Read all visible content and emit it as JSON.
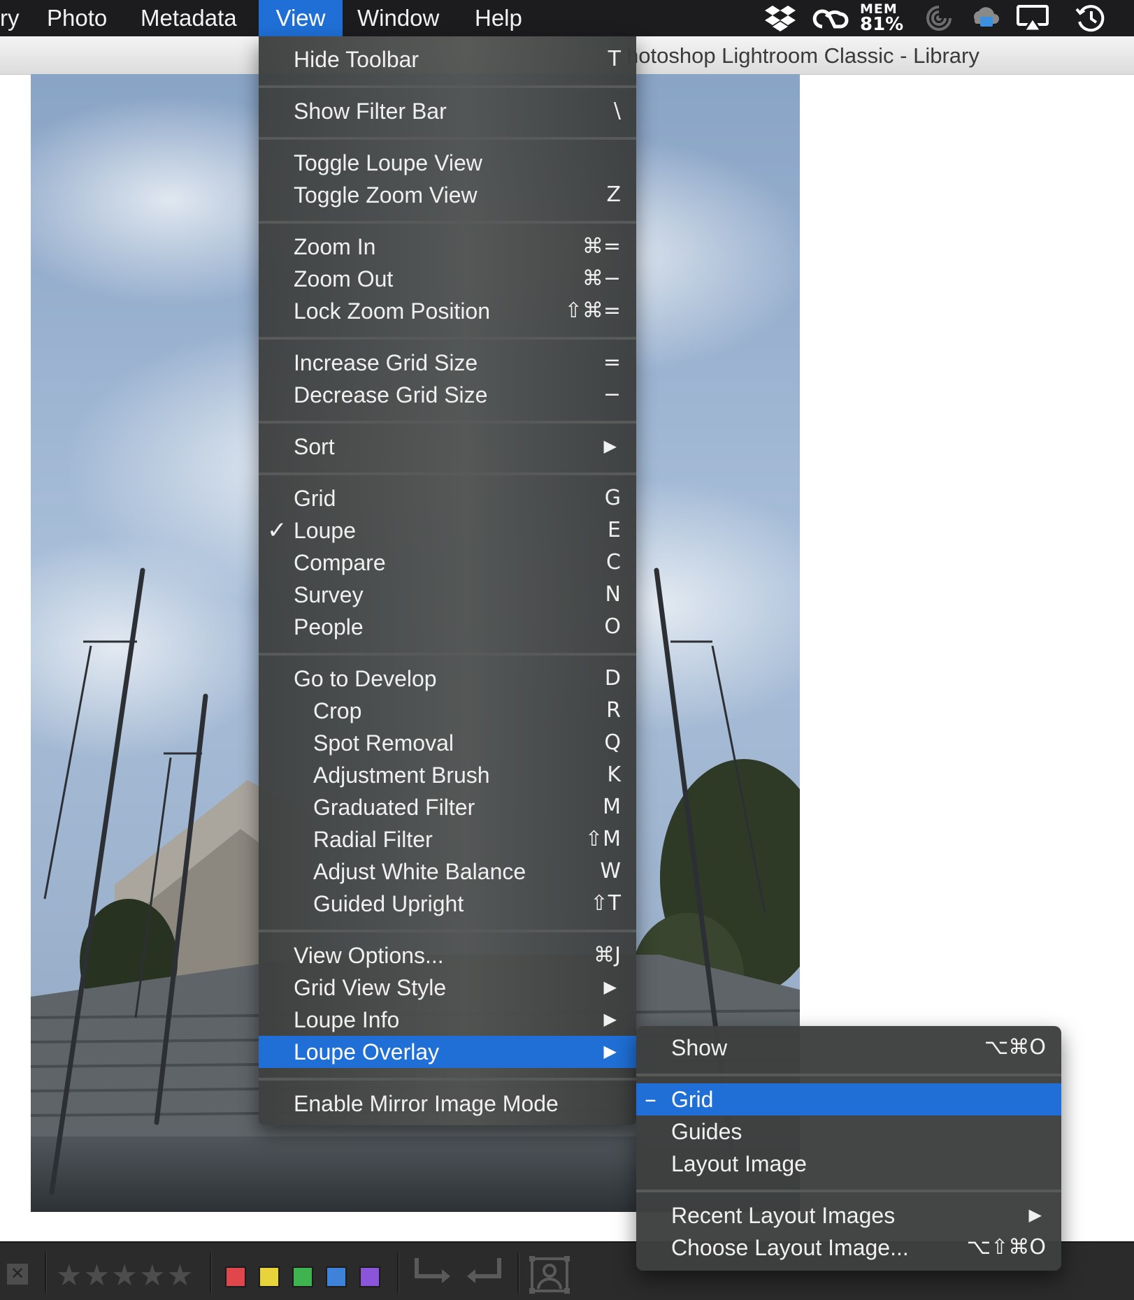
{
  "menubar": {
    "items": [
      {
        "label": "ry"
      },
      {
        "label": "Photo"
      },
      {
        "label": "Metadata"
      },
      {
        "label": "View"
      },
      {
        "label": "Window"
      },
      {
        "label": "Help"
      }
    ],
    "active": "View",
    "memory": {
      "label": "MEM",
      "value": "81%"
    },
    "tray_icons": [
      "dropbox-icon",
      "creative-cloud-icon",
      "spiral-icon",
      "cloud-backup-icon",
      "airplay-icon",
      "time-machine-icon"
    ]
  },
  "window": {
    "title": "hotoshop Lightroom Classic - Library"
  },
  "view_menu": {
    "items": [
      {
        "label": "Hide Toolbar",
        "shortcut": "T"
      },
      {
        "label": "Show Filter Bar",
        "shortcut": "\\"
      },
      {
        "label": "Toggle Loupe View",
        "shortcut": ""
      },
      {
        "label": "Toggle Zoom View",
        "shortcut": "Z"
      },
      {
        "label": "Zoom In",
        "shortcut": "⌘="
      },
      {
        "label": "Zoom Out",
        "shortcut": "⌘−"
      },
      {
        "label": "Lock Zoom Position",
        "shortcut": "⇧⌘="
      },
      {
        "label": "Increase Grid Size",
        "shortcut": "="
      },
      {
        "label": "Decrease Grid Size",
        "shortcut": "−"
      },
      {
        "label": "Sort",
        "submenu": true
      },
      {
        "label": "Grid",
        "shortcut": "G"
      },
      {
        "label": "Loupe",
        "shortcut": "E",
        "checked": true,
        "check_mark": "✓"
      },
      {
        "label": "Compare",
        "shortcut": "C"
      },
      {
        "label": "Survey",
        "shortcut": "N"
      },
      {
        "label": "People",
        "shortcut": "O"
      },
      {
        "label": "Go to Develop",
        "shortcut": "D"
      },
      {
        "label": "Crop",
        "shortcut": "R"
      },
      {
        "label": "Spot Removal",
        "shortcut": "Q"
      },
      {
        "label": "Adjustment Brush",
        "shortcut": "K"
      },
      {
        "label": "Graduated Filter",
        "shortcut": "M"
      },
      {
        "label": "Radial Filter",
        "shortcut": "⇧M"
      },
      {
        "label": "Adjust White Balance",
        "shortcut": "W"
      },
      {
        "label": "Guided Upright",
        "shortcut": "⇧T"
      },
      {
        "label": "View Options...",
        "shortcut": "⌘J"
      },
      {
        "label": "Grid View Style",
        "submenu": true
      },
      {
        "label": "Loupe Info",
        "submenu": true
      },
      {
        "label": "Loupe Overlay",
        "submenu": true,
        "highlighted": true
      },
      {
        "label": "Enable Mirror Image Mode",
        "shortcut": ""
      }
    ]
  },
  "loupe_overlay_submenu": {
    "items": [
      {
        "label": "Show",
        "shortcut": "⌥⌘O"
      },
      {
        "label": "Grid",
        "highlighted": true,
        "mark": "–"
      },
      {
        "label": "Guides"
      },
      {
        "label": "Layout Image"
      },
      {
        "label": "Recent Layout Images",
        "submenu": true
      },
      {
        "label": "Choose Layout Image...",
        "shortcut": "⌥⇧⌘O"
      }
    ]
  },
  "submenu_arrow": "▶",
  "toolbar": {
    "rating": "★★★★★",
    "close_glyph": "✕",
    "color_labels": [
      "#e0474c",
      "#e6d43a",
      "#3fb34f",
      "#3f82d9",
      "#8a55d8"
    ]
  },
  "colors": {
    "menu_highlight": "#1f6fd6",
    "menubar_bg": "#1c1c1e"
  }
}
